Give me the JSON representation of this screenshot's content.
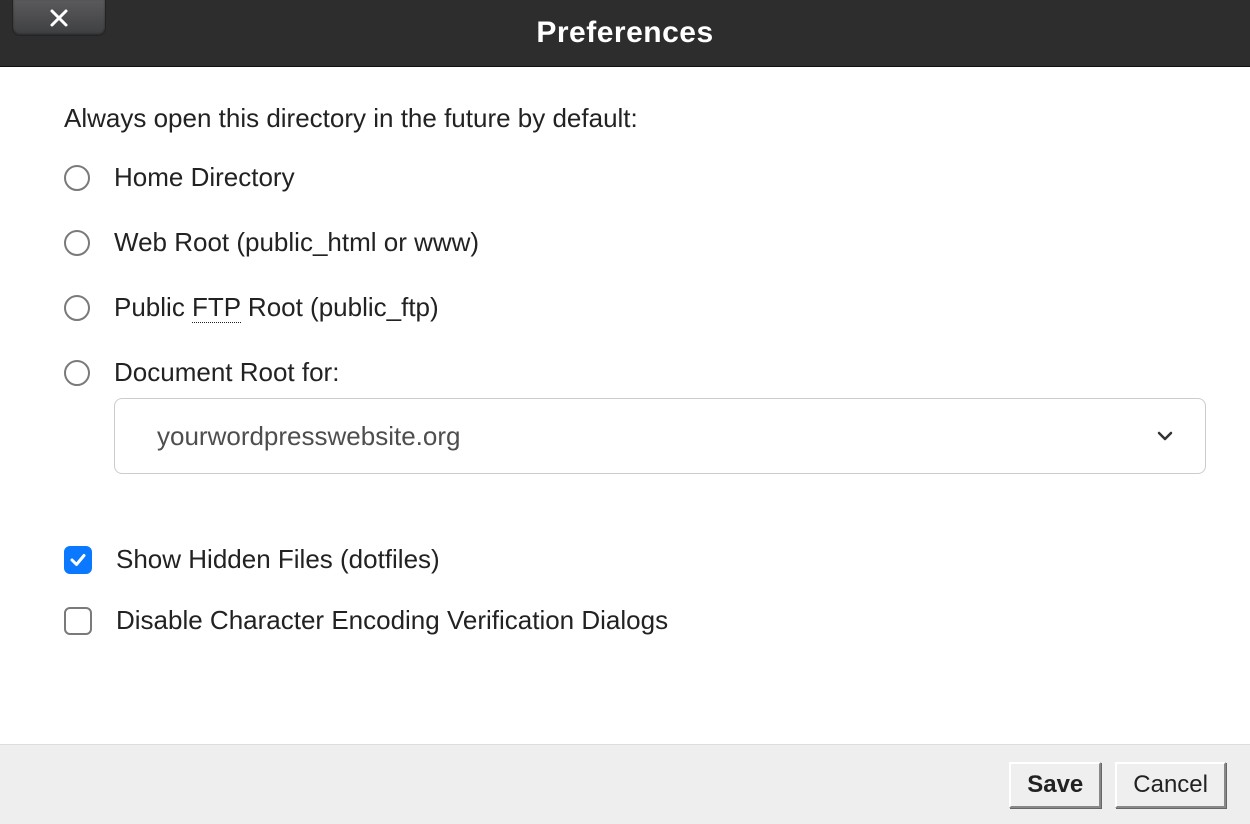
{
  "dialog": {
    "title": "Preferences",
    "prompt": "Always open this directory in the future by default:",
    "radios": [
      {
        "label": "Home Directory"
      },
      {
        "label_html": "Web Root (public_html or www)"
      },
      {
        "label_html": "Public <span class=\"ftp-underline\">FTP</span> Root (public_ftp)"
      },
      {
        "label": "Document Root for:"
      }
    ],
    "select_value": "yourwordpresswebsite.org",
    "checks": {
      "show_hidden": {
        "label": "Show Hidden Files (dotfiles)",
        "checked": true
      },
      "disable_enc": {
        "label": "Disable Character Encoding Verification Dialogs",
        "checked": false
      }
    },
    "buttons": {
      "save": "Save",
      "cancel": "Cancel"
    }
  }
}
